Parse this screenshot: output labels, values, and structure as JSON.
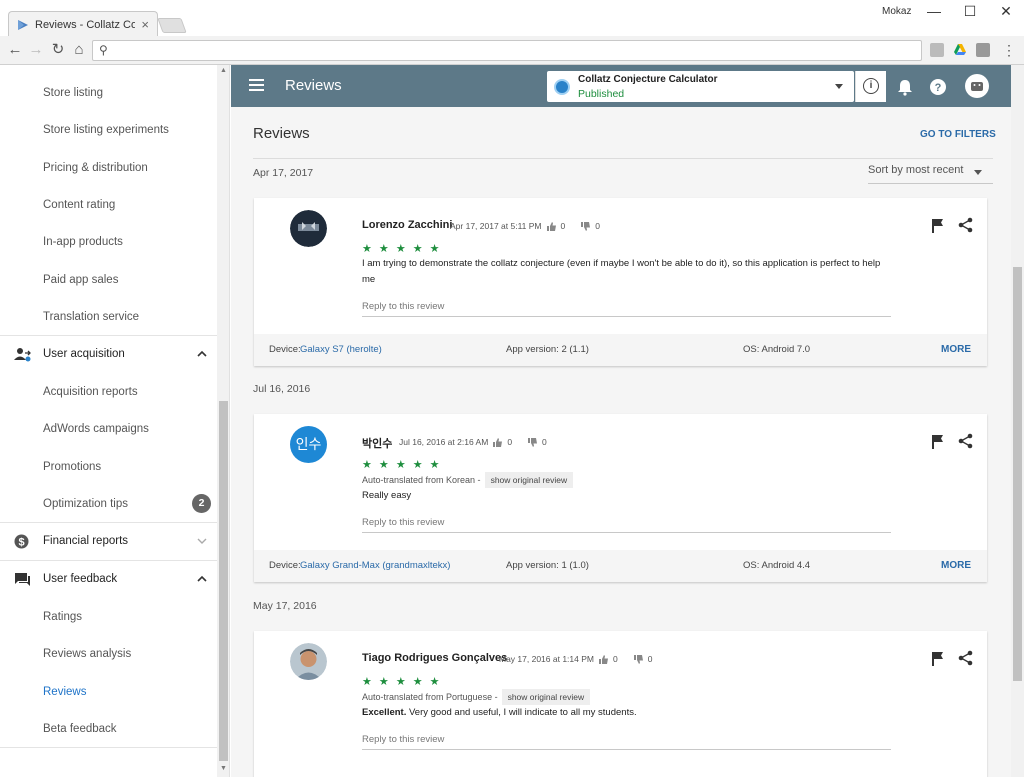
{
  "browser": {
    "tab_title": "Reviews - Collatz Conjecture",
    "user_name": "Mokaz",
    "minimize": "—",
    "maximize": "☐",
    "close": "✕"
  },
  "sidebar": {
    "items": [
      {
        "label": "Store listing",
        "name": "sidebar-item-store-listing"
      },
      {
        "label": "Store listing experiments",
        "name": "sidebar-item-store-listing-experiments"
      },
      {
        "label": "Pricing & distribution",
        "name": "sidebar-item-pricing-distribution"
      },
      {
        "label": "Content rating",
        "name": "sidebar-item-content-rating"
      },
      {
        "label": "In-app products",
        "name": "sidebar-item-in-app-products"
      },
      {
        "label": "Paid app sales",
        "name": "sidebar-item-paid-app-sales"
      },
      {
        "label": "Translation service",
        "name": "sidebar-item-translation-service"
      }
    ],
    "user_acquisition": {
      "label": "User acquisition",
      "items": [
        "Acquisition reports",
        "AdWords campaigns",
        "Promotions",
        "Optimization tips"
      ],
      "optimization_badge": "2"
    },
    "financial_reports": {
      "label": "Financial reports"
    },
    "user_feedback": {
      "label": "User feedback",
      "items": [
        "Ratings",
        "Reviews analysis",
        "Reviews",
        "Beta feedback"
      ]
    }
  },
  "header": {
    "title": "Reviews",
    "app_name": "Collatz Conjecture Calculator",
    "app_status": "Published",
    "info": "i"
  },
  "main": {
    "title": "Reviews",
    "go_to_filters": "GO TO FILTERS",
    "sort_label": "Sort by most recent",
    "reply_label": "Reply to this review",
    "more_label": "MORE",
    "show_original": "show original review",
    "reviews": [
      {
        "group_date": "Apr 17, 2017",
        "author": "Lorenzo Zacchini",
        "date": "Apr 17, 2017 at 5:11 PM",
        "likes": "0",
        "dislikes": "0",
        "stars": "★ ★ ★ ★ ★",
        "text": "I am trying to demonstrate the collatz conjecture (even if maybe I won't be able to do it), so this application is perfect to help me",
        "device_label": "Device:",
        "device": "Galaxy S7 (herolte)",
        "app_version": "App version: 2 (1.1)",
        "os": "OS: Android 7.0"
      },
      {
        "group_date": "Jul 16, 2016",
        "author": "박인수",
        "avatar_text": "인수",
        "date": "Jul 16, 2016 at 2:16 AM",
        "likes": "0",
        "dislikes": "0",
        "stars": "★ ★ ★ ★ ★",
        "translated": "Auto-translated from Korean -",
        "text": "Really easy",
        "device_label": "Device:",
        "device": "Galaxy Grand-Max (grandmaxltekx)",
        "app_version": "App version: 1 (1.0)",
        "os": "OS: Android 4.4"
      },
      {
        "group_date": "May 17, 2016",
        "author": "Tiago Rodrigues Gonçalves",
        "date": "May 17, 2016 at 1:14 PM",
        "likes": "0",
        "dislikes": "0",
        "stars": "★ ★ ★ ★ ★",
        "translated": "Auto-translated from Portuguese -",
        "text_bold": "Excellent.",
        "text": " Very good and useful, I will indicate to all my students."
      }
    ]
  },
  "colors": {
    "appbar": "#5d7988",
    "link": "#2a6aa8",
    "stars": "#1e8e3e",
    "active_nav": "#1e73c8"
  }
}
